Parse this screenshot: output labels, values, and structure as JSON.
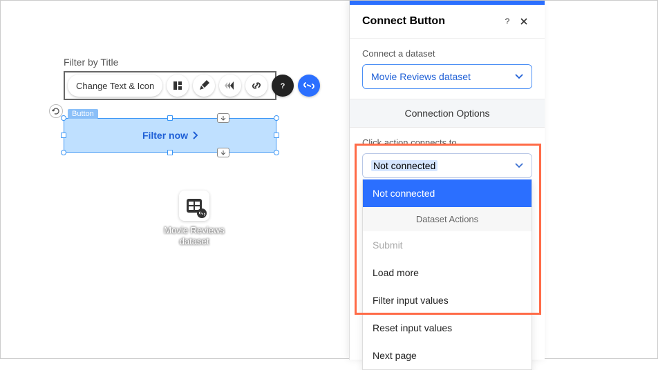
{
  "canvas": {
    "filter_label": "Filter by Title",
    "button_element_tag": "Button",
    "button_text": "Filter now",
    "dataset_name": "Movie Reviews dataset"
  },
  "toolbar": {
    "change_text_icon": "Change Text & Icon"
  },
  "panel": {
    "title": "Connect Button",
    "connect_label": "Connect a dataset",
    "connect_value": "Movie Reviews dataset",
    "options_header": "Connection Options",
    "click_label": "Click action connects to",
    "click_value": "Not connected",
    "menu": {
      "not_connected": "Not connected",
      "dataset_actions_header": "Dataset Actions",
      "submit": "Submit",
      "load_more": "Load more",
      "filter_input": "Filter input values",
      "reset_input": "Reset input values",
      "next_page": "Next page"
    }
  }
}
